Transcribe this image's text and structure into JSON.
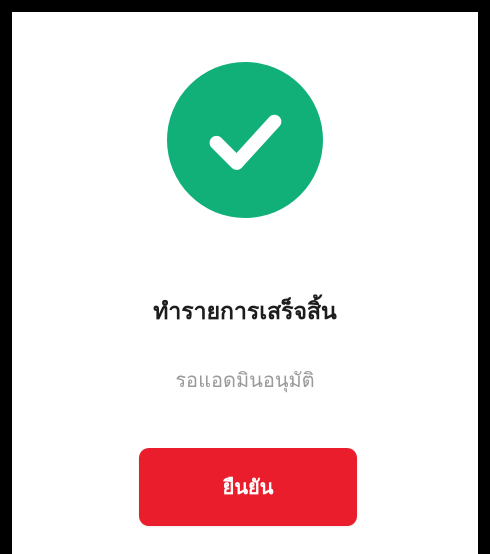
{
  "dialog": {
    "status_icon": "checkmark-icon",
    "title": "ทำรายการเสร็จสิ้น",
    "subtitle": "รอแอดมินอนุมัติ",
    "confirm_label": "ยืนยัน"
  },
  "colors": {
    "success": "#10b078",
    "button": "#ea1d2c",
    "title_text": "#1d1d1d",
    "subtitle_text": "#9a9a9a",
    "frame_border": "#000000"
  }
}
